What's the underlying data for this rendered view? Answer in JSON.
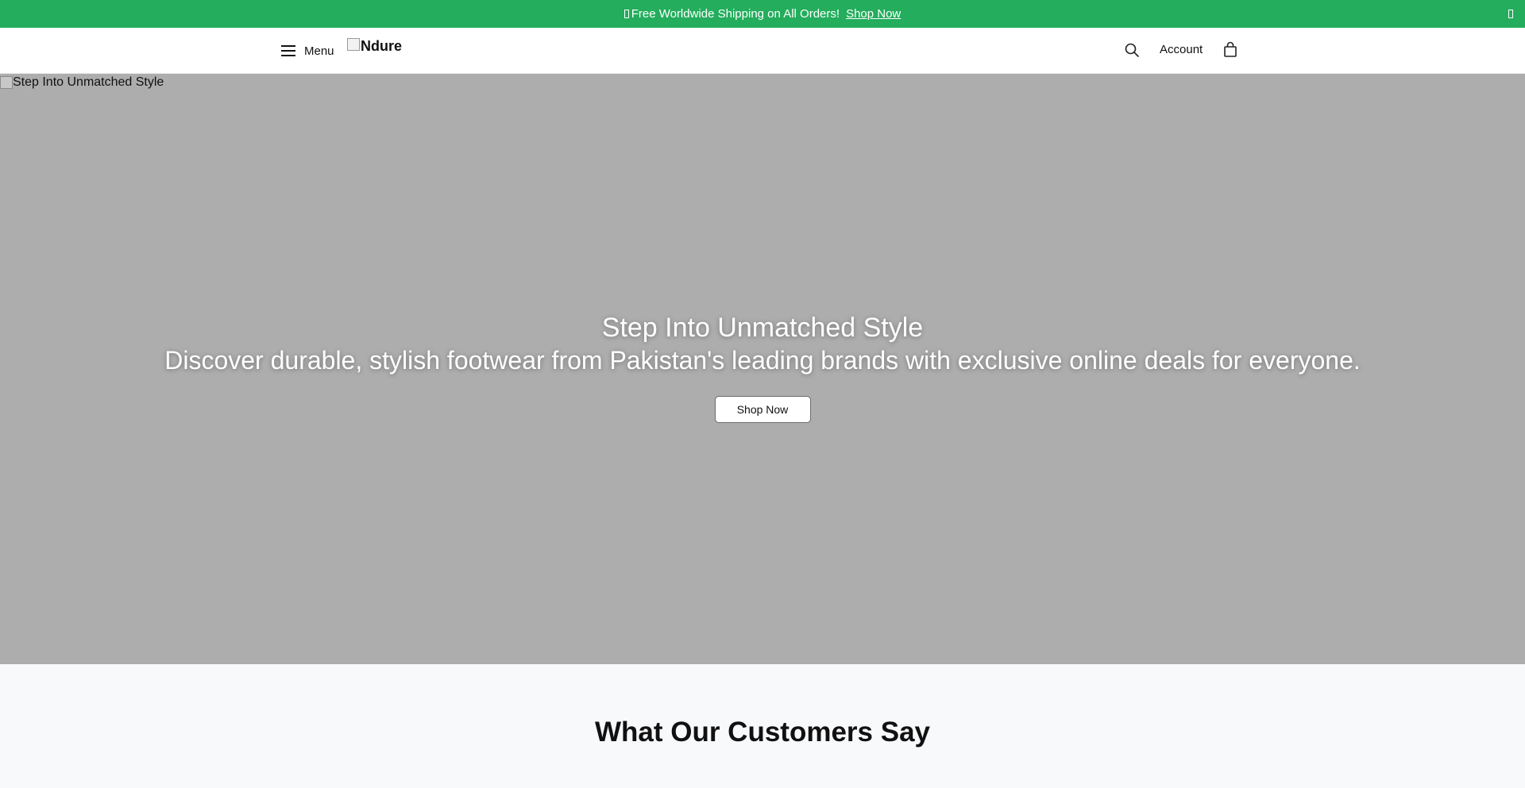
{
  "announcement": {
    "text": "Free Worldwide Shipping on All Orders!",
    "link_label": "Shop Now",
    "background": "#23ad5c"
  },
  "header": {
    "menu_label": "Menu",
    "logo_text": "Ndure",
    "account_label": "Account",
    "icons": [
      "hamburger-icon",
      "search-icon",
      "shopping-bag-icon"
    ]
  },
  "hero": {
    "image_alt": "Step Into Unmatched Style",
    "title": "Step Into Unmatched Style",
    "subtitle": "Discover durable, stylish footwear from Pakistan's leading brands with exclusive online deals for everyone.",
    "cta_label": "Shop Now",
    "background": "#adadad"
  },
  "testimonials": {
    "heading": "What Our Customers Say",
    "background": "#f8f9fb"
  }
}
